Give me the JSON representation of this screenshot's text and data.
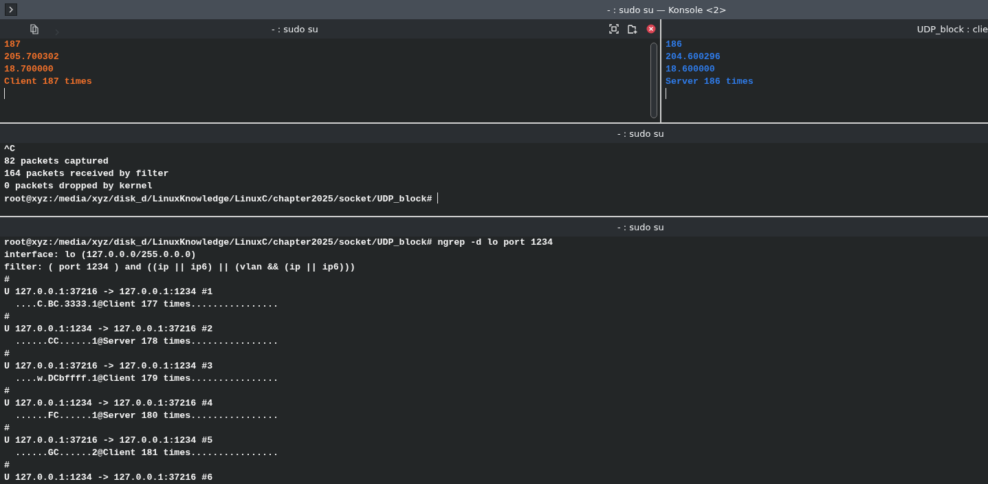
{
  "window": {
    "title": "- : sudo su — Konsole <2>"
  },
  "rows": [
    {
      "panes": [
        {
          "title": "- : sudo su",
          "color": "#f0702a",
          "toolbar": true,
          "scrollbar": true,
          "cursor": true,
          "lines": [
            "187",
            "205.700302",
            "18.700000",
            "Client 187 times"
          ]
        },
        {
          "title": "UDP_block : clie",
          "color": "#2f7be8",
          "cursor": true,
          "lines": [
            "186",
            "204.600296",
            "18.600000",
            "Server 186 times"
          ]
        }
      ]
    },
    {
      "panes": [
        {
          "title": "- : sudo su",
          "color": "#f4f4f4",
          "cursor": true,
          "lines": [
            "^C",
            "82 packets captured",
            "164 packets received by filter",
            "0 packets dropped by kernel",
            "root@xyz:/media/xyz/disk_d/LinuxKnowledge/LinuxC/chapter2025/socket/UDP_block# "
          ]
        }
      ]
    },
    {
      "panes": [
        {
          "title": "- : sudo su",
          "color": "#f4f4f4",
          "lines": [
            "root@xyz:/media/xyz/disk_d/LinuxKnowledge/LinuxC/chapter2025/socket/UDP_block# ngrep -d lo port 1234",
            "interface: lo (127.0.0.0/255.0.0.0)",
            "filter: ( port 1234 ) and ((ip || ip6) || (vlan && (ip || ip6)))",
            "#",
            "U 127.0.0.1:37216 -> 127.0.0.1:1234 #1",
            "  ....C.BC.3333.1@Client 177 times................",
            "#",
            "U 127.0.0.1:1234 -> 127.0.0.1:37216 #2",
            "  ......CC......1@Server 178 times................",
            "#",
            "U 127.0.0.1:37216 -> 127.0.0.1:1234 #3",
            "  ....w.DCbffff.1@Client 179 times................",
            "#",
            "U 127.0.0.1:1234 -> 127.0.0.1:37216 #4",
            "  ......FC......1@Server 180 times................",
            "#",
            "U 127.0.0.1:37216 -> 127.0.0.1:1234 #5",
            "  ......GC......2@Client 181 times................",
            "#",
            "U 127.0.0.1:1234 -> 127.0.0.1:37216 #6"
          ]
        }
      ]
    }
  ]
}
